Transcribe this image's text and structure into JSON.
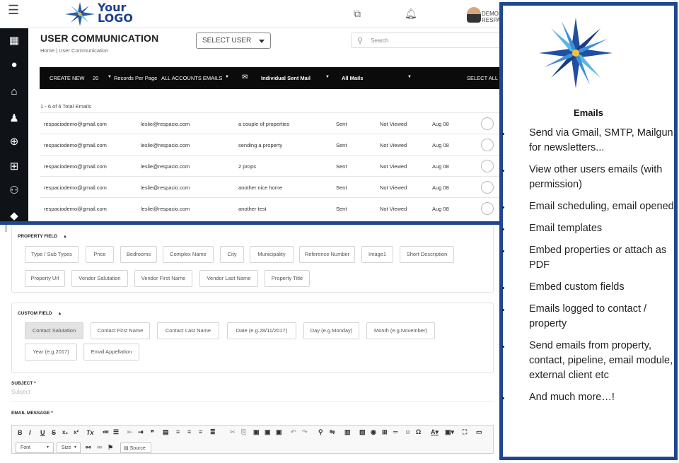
{
  "header": {
    "logo_line1": "Your",
    "logo_line2": "LOGO",
    "user_name": "DEMO RESPACIO"
  },
  "page": {
    "title": "USER COMMUNICATION",
    "breadcrumb": "Home  |  User Communication",
    "select_user": "SELECT USER",
    "search_placeholder": "Search"
  },
  "toolbar": {
    "create_new": "CREATE NEW",
    "records_count": "20",
    "records_label": "Records Per Page",
    "accounts": "ALL ACCOUNTS EMAILS",
    "sent_type": "Individual Sent Mail",
    "mail_filter": "All Mails",
    "select_all": "SELECT ALL"
  },
  "table": {
    "total": "1 - 6 of 6 Total Emails",
    "rows": [
      {
        "from": "respaciodemo@gmail.com",
        "to": "leslie@respacio.com",
        "subject": "a couple of properties",
        "status": "Sent",
        "viewed": "Not Viewed",
        "date": "Aug 08"
      },
      {
        "from": "respaciodemo@gmail.com",
        "to": "leslie@respacio.com",
        "subject": "sending a property",
        "status": "Sent",
        "viewed": "Not Viewed",
        "date": "Aug 08"
      },
      {
        "from": "respaciodemo@gmail.com",
        "to": "leslie@respacio.com",
        "subject": "2 props",
        "status": "Sent",
        "viewed": "Not Viewed",
        "date": "Aug 08"
      },
      {
        "from": "respaciodemo@gmail.com",
        "to": "leslie@respacio.com",
        "subject": "another nice home",
        "status": "Sent",
        "viewed": "Not Viewed",
        "date": "Aug 08"
      },
      {
        "from": "respaciodemo@gmail.com",
        "to": "leslie@respacio.com",
        "subject": "another test",
        "status": "Sent",
        "viewed": "Not Viewed",
        "date": "Aug 08"
      }
    ]
  },
  "property_field": {
    "title": "PROPERTY FIELD",
    "chips": [
      "Type / Sub Types",
      "Price",
      "Bedrooms",
      "Complex Name",
      "City",
      "Municipality",
      "Reference Number",
      "Image1",
      "Short Description",
      "Property Url",
      "Vendor Salutation",
      "Vendor First Name",
      "Vendor Last Name",
      "Property Title"
    ]
  },
  "custom_field": {
    "title": "CUSTOM FIELD",
    "chips": [
      "Contact Salutation",
      "Contact First Name",
      "Contact Last Name",
      "Date (e.g.28/11/2017)",
      "Day (e.g.Monday)",
      "Month (e.g.November)",
      "Year (e.g.2017)",
      "Email Appellation"
    ]
  },
  "compose": {
    "subject_label": "SUBJECT *",
    "subject_placeholder": "Subject",
    "message_label": "EMAIL MESSAGE *",
    "font_label": "Font",
    "size_label": "Size",
    "source_label": "Source"
  },
  "panel": {
    "title": "Emails",
    "features": [
      "Send via Gmail, SMTP, Mailgun for newsletters...",
      "View other users emails (with permission)",
      "Email scheduling, email opened",
      "Email templates",
      "Embed properties or attach as PDF",
      "Embed custom fields",
      "Emails logged to contact / property",
      "Send emails from property, contact, pipeline, email module,  external client etc",
      "And much more…!"
    ]
  },
  "colors": {
    "brand_blue": "#1f4690",
    "toolbar_bg": "#0b0b0b",
    "sidebar_bg": "#0f1216"
  }
}
